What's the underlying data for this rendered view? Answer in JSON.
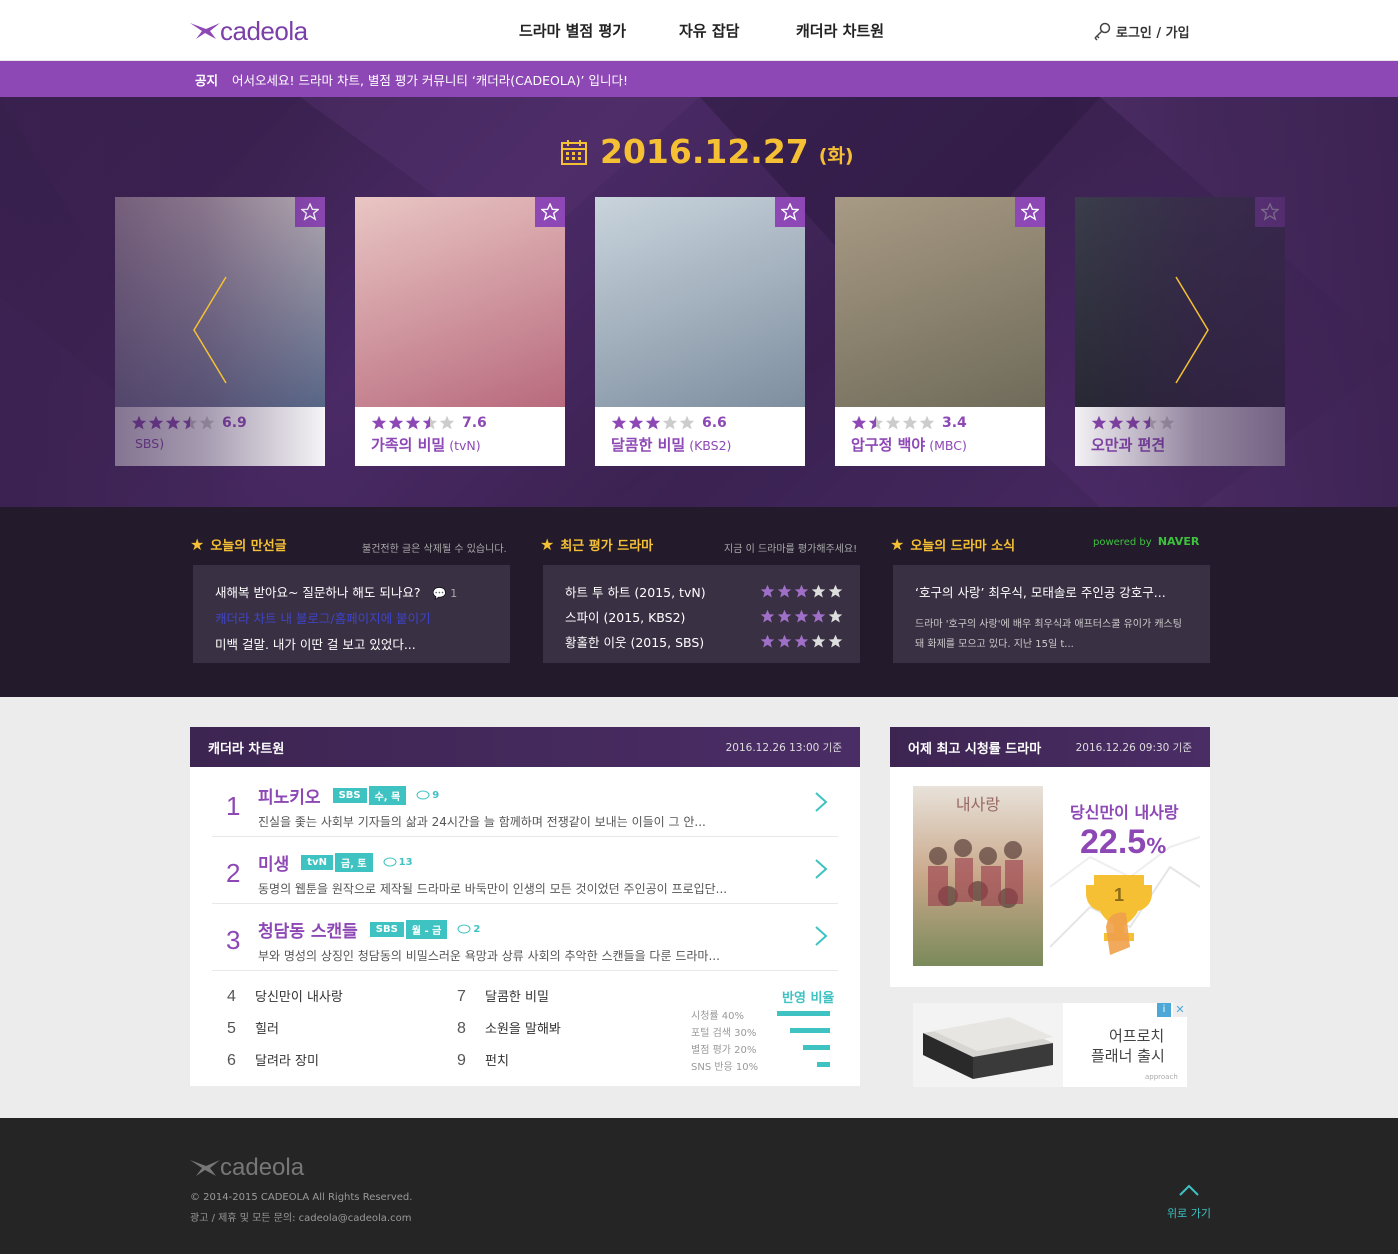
{
  "header": {
    "logo": "cadeola",
    "nav": [
      "드라마 별점 평가",
      "자유 잡담",
      "캐더라 차트원"
    ],
    "login": "로그인 / 가입"
  },
  "notice": {
    "label": "공지",
    "message": "어서오세요! 드라마 차트, 별점 평가 커뮤니티 ‘캐더라(CADEOLA)’ 입니다!"
  },
  "hero": {
    "date": "2016.12.27",
    "weekday": "(화)",
    "cards": [
      {
        "title": "",
        "rating": "6.9",
        "rating_value": 3.5,
        "channel": "SBS)",
        "poster_colors": [
          "#d8c6c4",
          "#5a6a8a"
        ]
      },
      {
        "title": "가족의 비밀",
        "rating": "7.6",
        "rating_value": 3.5,
        "channel": "(tvN)",
        "poster_colors": [
          "#e9c6c4",
          "#b86a7d"
        ]
      },
      {
        "title": "달콤한 비밀",
        "rating": "6.6",
        "rating_value": 3,
        "channel": "(KBS2)",
        "poster_colors": [
          "#c9d4dc",
          "#7e8ea0"
        ]
      },
      {
        "title": "압구정 백야",
        "rating": "3.4",
        "rating_value": 1.5,
        "channel": "(MBC)",
        "poster_colors": [
          "#a89a84",
          "#6f6b5a"
        ]
      },
      {
        "title": "오만과 편견",
        "rating": "",
        "rating_value": 3.5,
        "channel": "",
        "poster_colors": [
          "#3a3f4a",
          "#1f2229"
        ]
      }
    ]
  },
  "today_posts": {
    "title": "오늘의 만선글",
    "sub": "불건전한 글은 삭제될 수 있습니다.",
    "items": [
      {
        "text": "새해복 받아요~ 질문하나 해도 되나요?",
        "comments": "1"
      },
      {
        "text": "캐더라 차트 내 블로그/홈페이지에 붙이기",
        "comments": ""
      },
      {
        "text": "미백 걸말. 내가 이딴 걸 보고 있었다...",
        "comments": ""
      }
    ]
  },
  "recent_rated": {
    "title": "최근 평가 드라마",
    "sub": "지금 이 드라마를 평가해주세요!",
    "items": [
      {
        "text": "하트 투 하트 (2015, tvN)",
        "stars": 3
      },
      {
        "text": "스파이 (2015, KBS2)",
        "stars": 4
      },
      {
        "text": "황홀한 이웃 (2015, SBS)",
        "stars": 3
      }
    ]
  },
  "drama_news": {
    "title": "오늘의 드라마 소식",
    "powered_prefix": "powered by",
    "powered_brand": "NAVER",
    "headline": "‘호구의 사랑’ 최우식, 모태솔로 주인공 강호구...",
    "body_line1": "드라마 '호구의 사랑'에 배우 최우식과 애프터스쿨 유이가 캐스팅",
    "body_line2": "돼 화제를 모으고 있다. 지난 15일 t..."
  },
  "chart": {
    "title": "캐더라 차트원",
    "timestamp": "2016.12.26 13:00 기준",
    "top": [
      {
        "rank": "1",
        "title": "피노키오",
        "tags": [
          "SBS",
          "수, 목"
        ],
        "comments": "9",
        "desc": "진실을 좇는 사회부 기자들의 삶과 24시간을 늘 함께하며 전쟁같이 보내는 이들이 그 안..."
      },
      {
        "rank": "2",
        "title": "미생",
        "tags": [
          "tvN",
          "금, 토"
        ],
        "comments": "13",
        "desc": "동명의 웹툰을 원작으로 제작될 드라마로 바둑만이 인생의 모든 것이었던 주인공이 프로입단..."
      },
      {
        "rank": "3",
        "title": "청담동 스캔들",
        "tags": [
          "SBS",
          "월 - 금"
        ],
        "comments": "2",
        "desc": "부와 명성의 상징인 청담동의 비밀스러운 욕망과 상류 사회의 추악한 스캔들을 다룬 드라마..."
      }
    ],
    "rest": [
      {
        "rank": "4",
        "title": "당신만이 내사랑"
      },
      {
        "rank": "5",
        "title": "힐러"
      },
      {
        "rank": "6",
        "title": "달려라 장미"
      },
      {
        "rank": "7",
        "title": "달콤한 비밀"
      },
      {
        "rank": "8",
        "title": "소원을 말해봐"
      },
      {
        "rank": "9",
        "title": "펀치"
      }
    ],
    "ratio_title": "반영 비율",
    "ratios": [
      {
        "label": "시청률 40%",
        "value": 40
      },
      {
        "label": "포털 검색 30%",
        "value": 30
      },
      {
        "label": "별점 평가 20%",
        "value": 20
      },
      {
        "label": "SNS 반응 10%",
        "value": 10
      }
    ]
  },
  "top_rating": {
    "title": "어제 최고 시청률 드라마",
    "timestamp": "2016.12.26 09:30 기준",
    "drama": "당신만이 내사랑",
    "value": "22.5",
    "unit": "%",
    "rank": "1"
  },
  "ad": {
    "line1": "어프로치",
    "line2": "플래너 출시",
    "brand": "approach"
  },
  "footer": {
    "logo": "cadeola",
    "copyright": "© 2014-2015 CADEOLA All Rights Reserved.",
    "contact": "광고 / 제휴 및 모든 문의: cadeola@cadeola.com",
    "top": "위로 가기"
  },
  "colors": {
    "purple": "#8d48b5",
    "gold": "#f5c033",
    "teal": "#3ec2c2"
  }
}
